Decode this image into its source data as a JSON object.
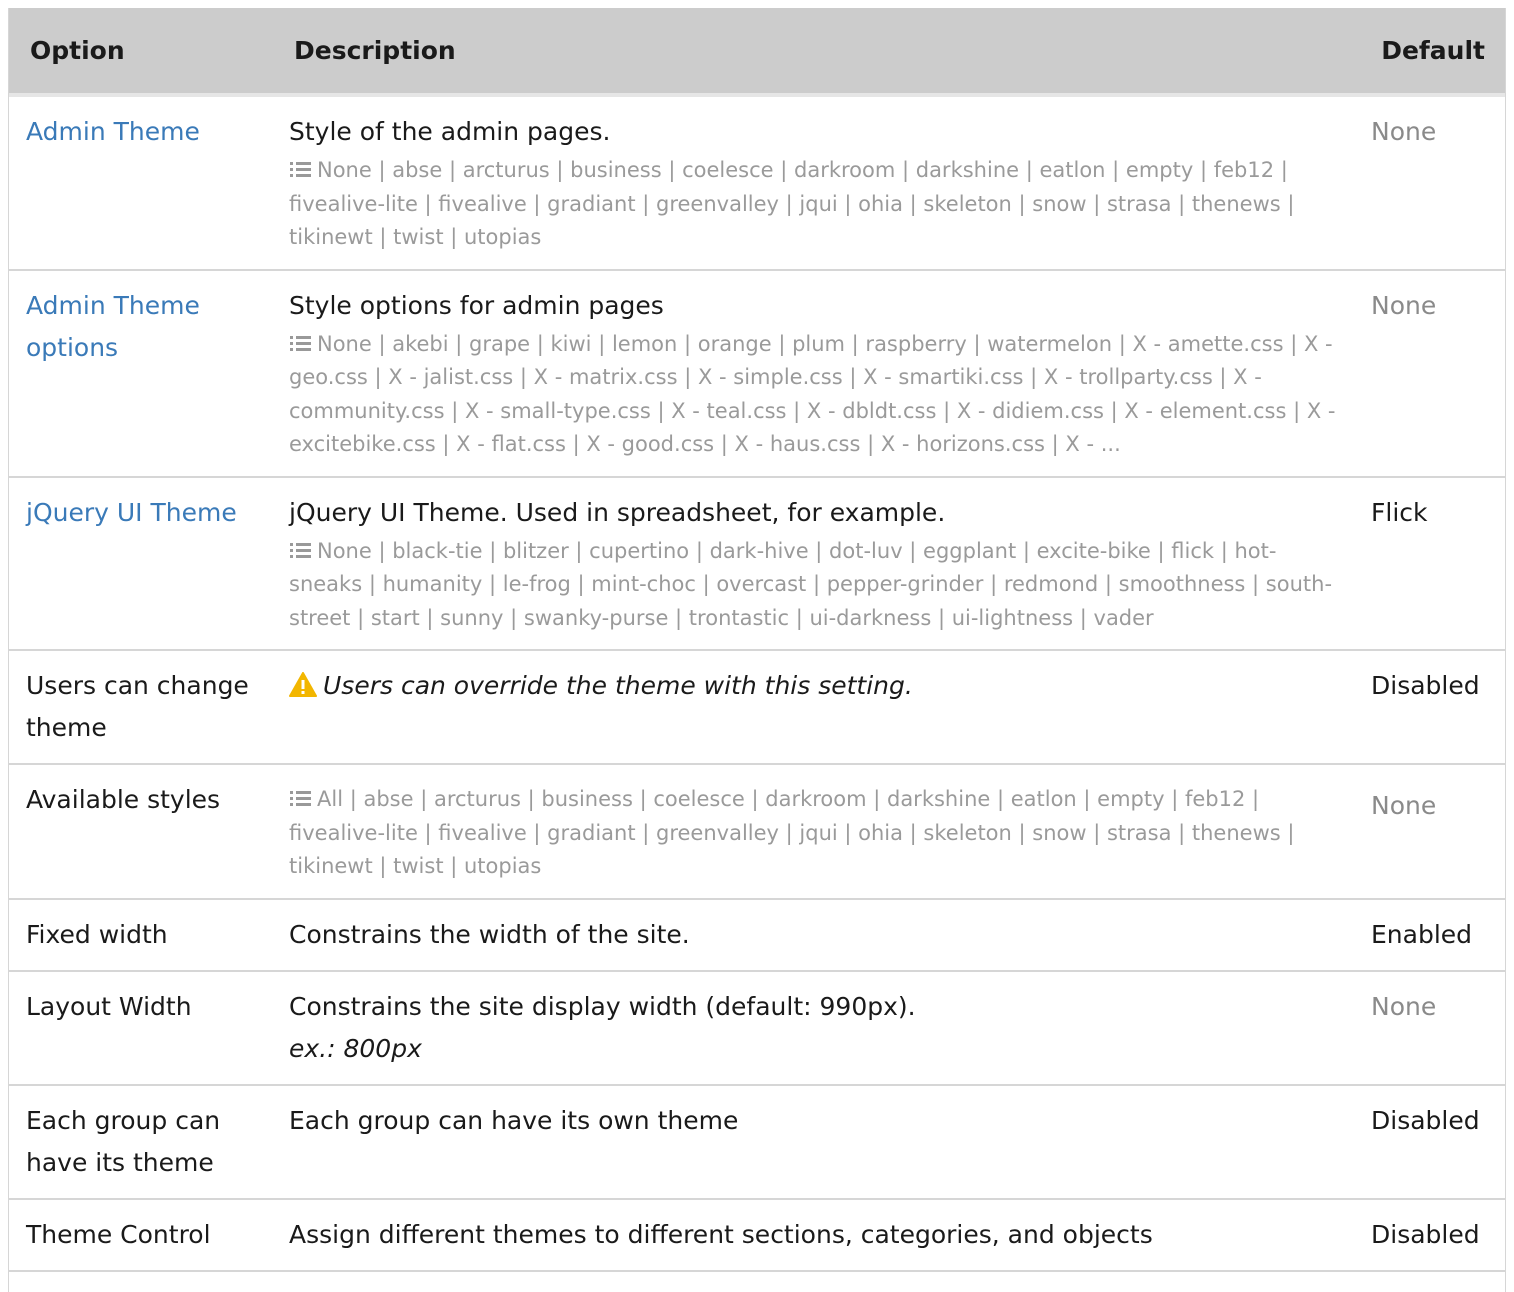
{
  "headers": {
    "option": "Option",
    "description": "Description",
    "default": "Default"
  },
  "rows": [
    {
      "option": "Admin Theme",
      "option_is_link": true,
      "description": "Style of the admin pages.",
      "choices": "None | abse | arcturus | business | coelesce | darkroom | darkshine | eatlon | empty | feb12 | fivealive-lite | fivealive | gradiant | greenvalley | jqui | ohia | skeleton | snow | strasa | thenews | tikinewt | twist | utopias",
      "default": "None",
      "default_muted": true
    },
    {
      "option": "Admin Theme options",
      "option_is_link": true,
      "description": "Style options for admin pages",
      "choices": "None | akebi | grape | kiwi | lemon | orange | plum | raspberry | watermelon | X - amette.css | X - geo.css | X - jalist.css | X - matrix.css | X - simple.css | X - smartiki.css | X - trollparty.css | X - community.css | X - small-type.css | X - teal.css | X - dbldt.css | X - didiem.css | X - element.css | X - excitebike.css | X - flat.css | X - good.css | X - haus.css | X - horizons.css | X - ...",
      "default": "None",
      "default_muted": true
    },
    {
      "option": "jQuery UI Theme",
      "option_is_link": true,
      "description": "jQuery UI Theme. Used in spreadsheet, for example.",
      "choices": "None | black-tie | blitzer | cupertino | dark-hive | dot-luv | eggplant | excite-bike | flick | hot-sneaks | humanity | le-frog | mint-choc | overcast | pepper-grinder | redmond | smoothness | south-street | start | sunny | swanky-purse | trontastic | ui-darkness | ui-lightness | vader",
      "default": "Flick",
      "default_muted": false
    },
    {
      "option": "Users can change theme",
      "option_is_link": false,
      "warning": "Users can override the theme with this setting.",
      "default": "Disabled",
      "default_muted": false
    },
    {
      "option": "Available styles",
      "option_is_link": false,
      "choices": "All | abse | arcturus | business | coelesce | darkroom | darkshine | eatlon | empty | feb12 | fivealive-lite | fivealive | gradiant | greenvalley | jqui | ohia | skeleton | snow | strasa | thenews | tikinewt | twist | utopias",
      "default": "None",
      "default_muted": true
    },
    {
      "option": "Fixed width",
      "option_is_link": false,
      "description": "Constrains the width of the site.",
      "default": "Enabled",
      "default_muted": false
    },
    {
      "option": "Layout Width",
      "option_is_link": false,
      "description": "Constrains the site display width (default: 990px).",
      "example": "ex.: 800px",
      "default": "None",
      "default_muted": true
    },
    {
      "option": "Each group can have its theme",
      "option_is_link": false,
      "description": "Each group can have its own theme",
      "default": "Disabled",
      "default_muted": false
    },
    {
      "option": "Theme Control",
      "option_is_link": false,
      "description": "Assign different themes to different sections, categories, and objects",
      "default": "Disabled",
      "default_muted": false
    }
  ],
  "colors": {
    "header_bg": "#cccccc",
    "link": "#3a7ab8",
    "muted": "#8a8a8a",
    "choices": "#9a9a9a",
    "warning": "#f2b600"
  },
  "icons": {
    "choices": "list-icon",
    "warning": "warning-icon"
  }
}
